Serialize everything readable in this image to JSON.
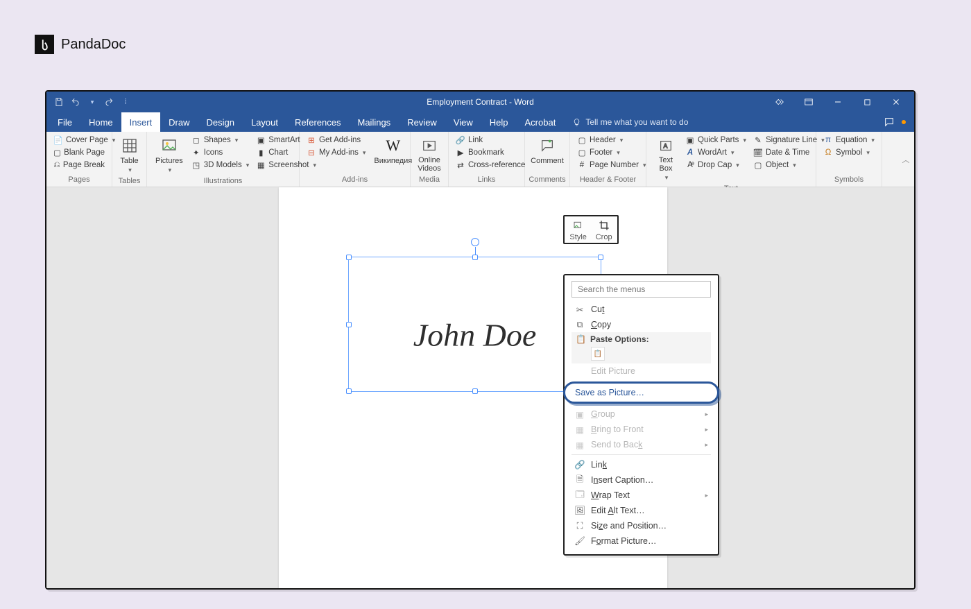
{
  "brand": {
    "name": "PandaDoc"
  },
  "titlebar": {
    "title": "Employment Contract - Word"
  },
  "tabs": {
    "items": [
      "File",
      "Home",
      "Insert",
      "Draw",
      "Design",
      "Layout",
      "References",
      "Mailings",
      "Review",
      "View",
      "Help",
      "Acrobat"
    ],
    "active": "Insert",
    "tellme": "Tell me what you want to do"
  },
  "ribbon": {
    "pages": {
      "label": "Pages",
      "cover_page": "Cover Page",
      "blank_page": "Blank Page",
      "page_break": "Page Break"
    },
    "tables": {
      "label": "Tables",
      "table": "Table"
    },
    "illustrations": {
      "label": "Illustrations",
      "pictures": "Pictures",
      "shapes": "Shapes",
      "icons": "Icons",
      "models": "3D Models",
      "smartart": "SmartArt",
      "chart": "Chart",
      "screenshot": "Screenshot"
    },
    "addins": {
      "label": "Add-ins",
      "get": "Get Add-ins",
      "my": "My Add-ins",
      "wiki": "Википедия"
    },
    "media": {
      "label": "Media",
      "online_videos": "Online Videos"
    },
    "links": {
      "label": "Links",
      "link": "Link",
      "bookmark": "Bookmark",
      "crossref": "Cross-reference"
    },
    "comments": {
      "label": "Comments",
      "comment": "Comment"
    },
    "header_footer": {
      "label": "Header & Footer",
      "header": "Header",
      "footer": "Footer",
      "page_number": "Page Number"
    },
    "text": {
      "label": "Text",
      "text_box": "Text Box",
      "quick_parts": "Quick Parts",
      "wordart": "WordArt",
      "drop_cap": "Drop Cap",
      "sig_line": "Signature Line",
      "date_time": "Date & Time",
      "object": "Object"
    },
    "symbols": {
      "label": "Symbols",
      "equation": "Equation",
      "symbol": "Symbol"
    }
  },
  "signature": {
    "text": "John Doe"
  },
  "mini_toolbar": {
    "style": "Style",
    "crop": "Crop"
  },
  "context_menu": {
    "search_placeholder": "Search the menus",
    "cut": "Cut",
    "copy": "Copy",
    "paste_options": "Paste Options:",
    "edit_picture": "Edit Picture",
    "save_as_picture": "Save as Picture…",
    "group": "Group",
    "bring_front": "Bring to Front",
    "send_back": "Send to Back",
    "link": "Link",
    "insert_caption": "Insert Caption…",
    "wrap_text": "Wrap Text",
    "edit_alt": "Edit Alt Text…",
    "size_position": "Size and Position…",
    "format_picture": "Format Picture…"
  }
}
